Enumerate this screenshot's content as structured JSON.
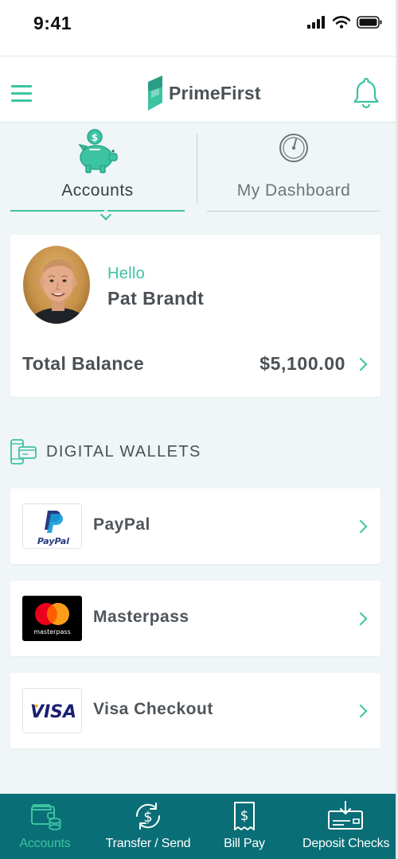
{
  "status_bar": {
    "time": "9:41"
  },
  "header": {
    "app_name": "PrimeFirst"
  },
  "tabs": [
    {
      "label": "Accounts",
      "icon": "piggy-bank-icon",
      "active": true
    },
    {
      "label": "My Dashboard",
      "icon": "speedometer-icon",
      "active": false
    }
  ],
  "profile": {
    "greeting": "Hello",
    "name": "Pat Brandt",
    "balance_label": "Total Balance",
    "balance_value": "$5,100.00"
  },
  "digital_wallets": {
    "title": "DIGITAL WALLETS",
    "items": [
      {
        "name": "PayPal",
        "logo_text": "PayPal"
      },
      {
        "name": "Masterpass",
        "logo_text": "masterpass"
      },
      {
        "name": "Visa Checkout",
        "logo_text": "VISA"
      }
    ]
  },
  "bottom_nav": [
    {
      "label": "Accounts",
      "icon": "wallet-coins-icon",
      "active": true
    },
    {
      "label": "Transfer / Send",
      "icon": "transfer-dollar-icon",
      "active": false
    },
    {
      "label": "Bill Pay",
      "icon": "bill-receipt-icon",
      "active": false
    },
    {
      "label": "Deposit Checks",
      "icon": "deposit-check-icon",
      "active": false
    }
  ],
  "colors": {
    "accent": "#3cc3a2",
    "nav_bg": "#0a6e76",
    "text": "#4a5055",
    "background": "#f0f5f7"
  }
}
